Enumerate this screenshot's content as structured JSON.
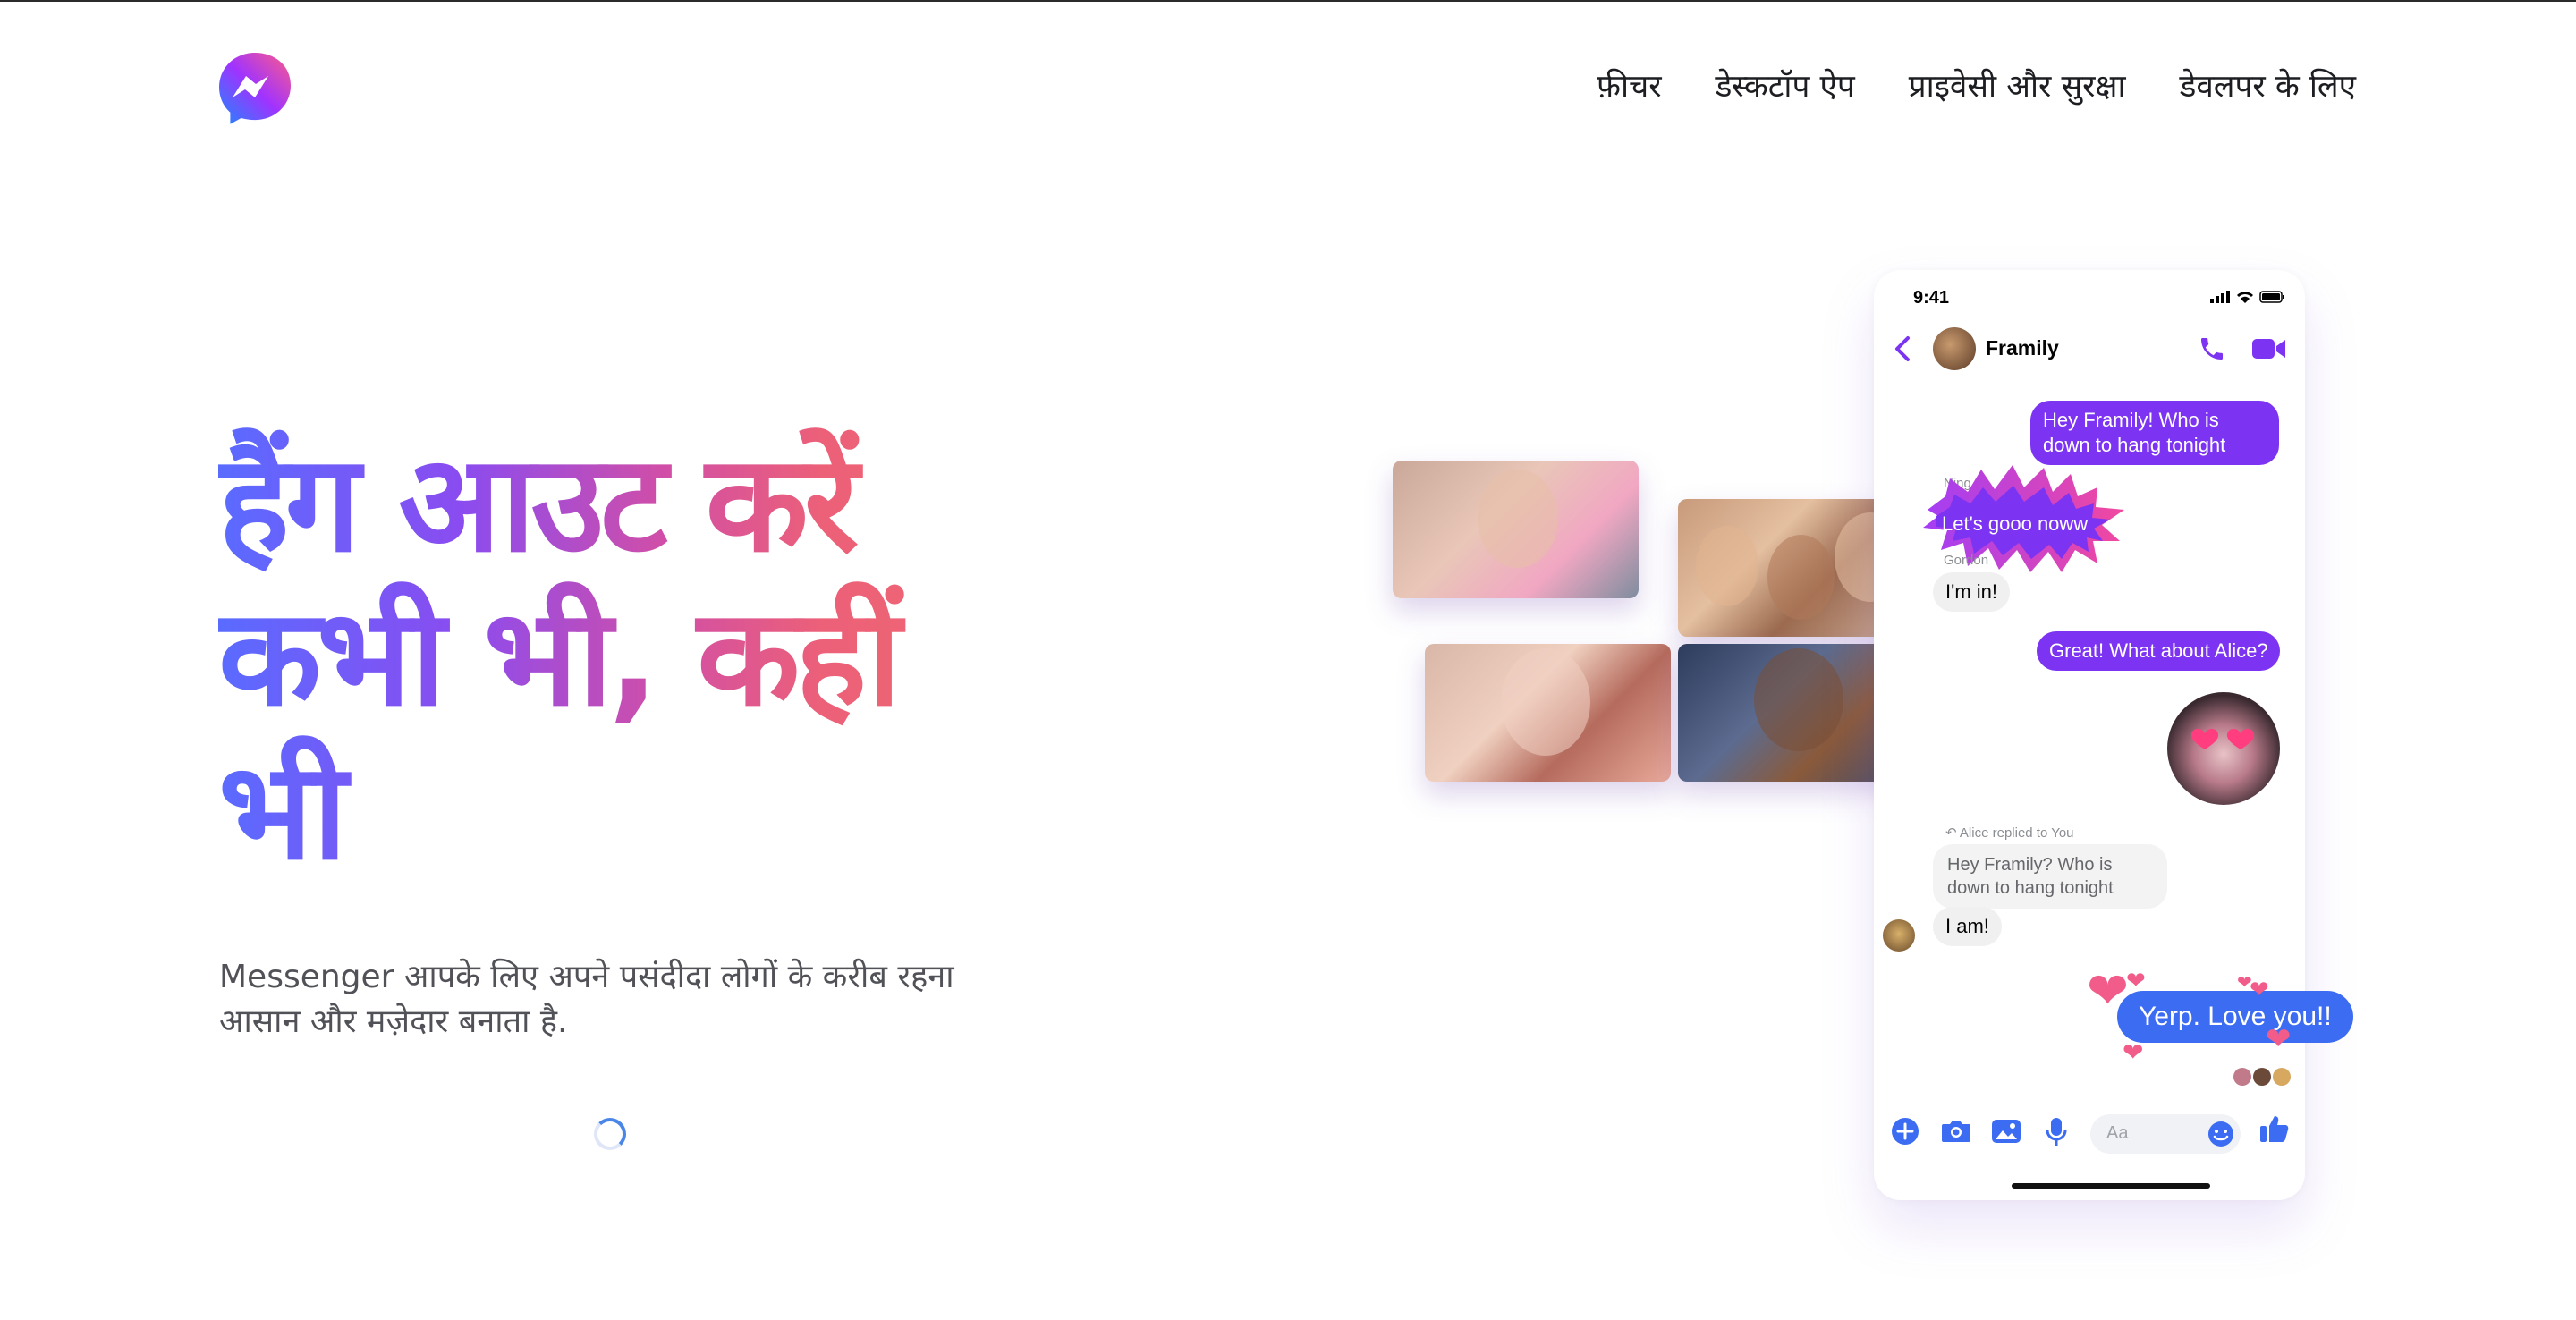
{
  "nav": {
    "features": "फ़ीचर",
    "desktop_app": "डेस्कटॉप ऐप",
    "privacy_safety": "प्राइवेसी और सुरक्षा",
    "developers": "डेवलपर के लिए"
  },
  "hero": {
    "headline_line1": "हैंग आउट करें",
    "headline_line2": "कभी भी, कहीं",
    "headline_line3": "भी",
    "subtitle_line1": "Messenger आपके लिए अपने पसंदीदा लोगों के करीब रहना",
    "subtitle_line2": "आसान और मज़ेदार बनाता है."
  },
  "phone": {
    "status_time": "9:41",
    "chat_name": "Framily",
    "messages": {
      "m1": "Hey Framily! Who is down to hang tonight",
      "sender_ning": "Ning",
      "m2": "Let's gooo noww",
      "sender_gordon": "Gordon",
      "m3": "I'm in!",
      "m4": "Great! What about Alice?",
      "replied_label": "Alice replied to You",
      "quoted": "Hey Framily? Who is down to hang tonight",
      "m5": "I am!",
      "m6": "Yerp. Love you!!"
    },
    "composer_placeholder": "Aa"
  },
  "colors": {
    "brand_purple": "#7c33f2",
    "brand_blue": "#3b6cf2",
    "heart_pink": "#f25c8a"
  }
}
